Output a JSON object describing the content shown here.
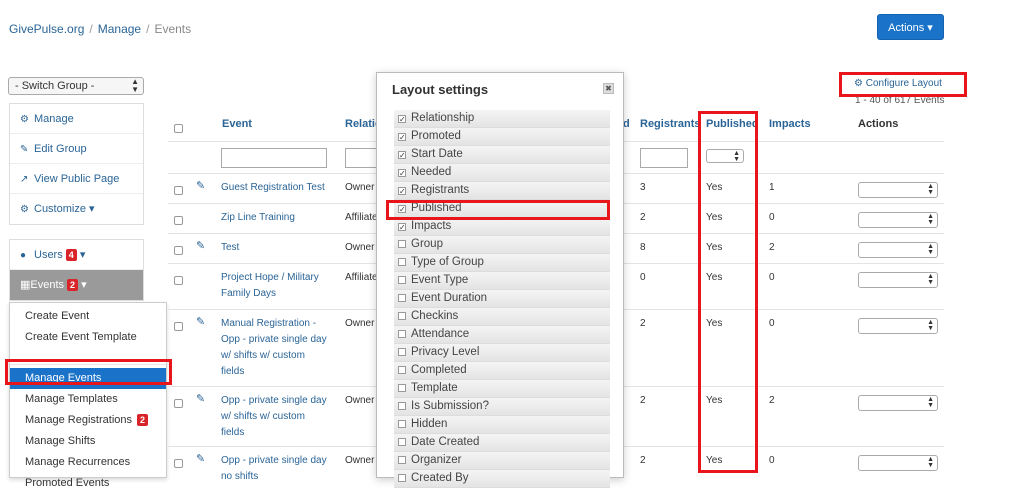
{
  "breadcrumb": {
    "items": [
      "GivePulse.org",
      "Manage"
    ],
    "current": "Events",
    "separator": "/"
  },
  "header": {
    "actions_label": "Actions ▾"
  },
  "sidebar": {
    "switch_group": "- Switch Group -",
    "group_items": [
      {
        "icon": "gears-icon",
        "label": "Manage"
      },
      {
        "icon": "pencil-icon",
        "label": "Edit Group"
      },
      {
        "icon": "external-link-icon",
        "label": "View Public Page"
      },
      {
        "icon": "gears-icon",
        "label": "Customize ▾"
      }
    ],
    "users": {
      "label": "Users",
      "badge": "4"
    },
    "events": {
      "label": "Events",
      "badge": "2"
    }
  },
  "events_menu": {
    "items": [
      {
        "label": "Create Event"
      },
      {
        "label": "Create Event Template"
      },
      {
        "label": "Manage Events"
      },
      {
        "label": "Manage Templates"
      },
      {
        "label": "Manage Registrations",
        "badge": "2"
      },
      {
        "label": "Manage Shifts"
      },
      {
        "label": "Manage Recurrences"
      },
      {
        "label": "Promoted Events"
      }
    ],
    "active": "Manage Events"
  },
  "toolbar": {
    "configure_label": "Configure Layout",
    "count_text": "1 - 40 of 617 Events"
  },
  "table": {
    "columns": {
      "event": "Event",
      "relationship": "Relatio",
      "needed": "d",
      "registrants": "Registrants",
      "published": "Published",
      "impacts": "Impacts",
      "actions": "Actions"
    },
    "rows": [
      {
        "event": [
          "Guest Registration Test"
        ],
        "relationship": "Owner",
        "registrants": "3",
        "published": "Yes",
        "impacts": "1",
        "pencil": true
      },
      {
        "event": [
          "Zip Line Training"
        ],
        "relationship": "Affiliate",
        "registrants": "2",
        "published": "Yes",
        "impacts": "0",
        "pencil": false
      },
      {
        "event": [
          "Test"
        ],
        "relationship": "Owner",
        "registrants": "8",
        "published": "Yes",
        "impacts": "2",
        "pencil": true
      },
      {
        "event": [
          "Project Hope / Military",
          "Family Days"
        ],
        "relationship": "Affiliate",
        "registrants": "0",
        "published": "Yes",
        "impacts": "0",
        "pencil": false
      },
      {
        "event": [
          "Manual Registration -",
          "Opp - private single day",
          "w/ shifts w/ custom",
          "fields"
        ],
        "relationship": "Owner",
        "registrants": "2",
        "published": "Yes",
        "impacts": "0",
        "pencil": true
      },
      {
        "event": [
          "Opp - private single day",
          "w/ shifts w/ custom",
          "fields"
        ],
        "relationship": "Owner",
        "registrants": "2",
        "published": "Yes",
        "impacts": "2",
        "pencil": true
      },
      {
        "event": [
          "Opp - private single day",
          "no shifts"
        ],
        "relationship": "Owner",
        "registrants": "2",
        "published": "Yes",
        "impacts": "0",
        "pencil": true
      }
    ]
  },
  "layout_settings": {
    "title": "Layout settings",
    "close_label": "✖",
    "options": [
      {
        "label": "Relationship",
        "checked": true
      },
      {
        "label": "Promoted",
        "checked": true
      },
      {
        "label": "Start Date",
        "checked": true
      },
      {
        "label": "Needed",
        "checked": true
      },
      {
        "label": "Registrants",
        "checked": true
      },
      {
        "label": "Published",
        "checked": true
      },
      {
        "label": "Impacts",
        "checked": true
      },
      {
        "label": "Group",
        "checked": false
      },
      {
        "label": "Type of Group",
        "checked": false
      },
      {
        "label": "Event Type",
        "checked": false
      },
      {
        "label": "Event Duration",
        "checked": false
      },
      {
        "label": "Checkins",
        "checked": false
      },
      {
        "label": "Attendance",
        "checked": false
      },
      {
        "label": "Privacy Level",
        "checked": false
      },
      {
        "label": "Completed",
        "checked": false
      },
      {
        "label": "Template",
        "checked": false
      },
      {
        "label": "Is Submission?",
        "checked": false
      },
      {
        "label": "Hidden",
        "checked": false
      },
      {
        "label": "Date Created",
        "checked": false
      },
      {
        "label": "Organizer",
        "checked": false
      },
      {
        "label": "Created By",
        "checked": false
      }
    ]
  },
  "colors": {
    "accent": "#1a73c9",
    "link": "#2a6496",
    "highlight": "#e8151b",
    "badge": "#d9252a"
  }
}
